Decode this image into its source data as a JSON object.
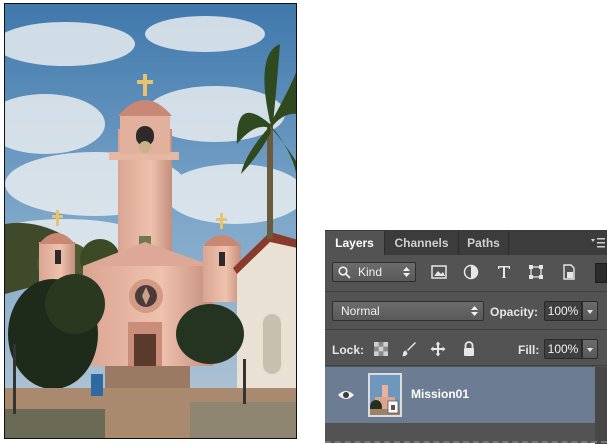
{
  "photo": {
    "subject": "Mission church with bell tower, palm tree and blue sky"
  },
  "layers_panel": {
    "tabs": [
      {
        "label": "Layers",
        "active": true
      },
      {
        "label": "Channels",
        "active": false
      },
      {
        "label": "Paths",
        "active": false
      }
    ],
    "filter": {
      "kind_label": "Kind",
      "icons": [
        "pixel-layer-filter-icon",
        "adjustment-layer-filter-icon",
        "type-layer-filter-icon",
        "shape-layer-filter-icon",
        "smart-object-filter-icon"
      ]
    },
    "blend_mode": "Normal",
    "opacity_label": "Opacity:",
    "opacity_value": "100%",
    "lock_label": "Lock:",
    "lock_icons": [
      "lock-transparent-pixels-icon",
      "lock-image-pixels-icon",
      "lock-position-icon",
      "lock-all-icon"
    ],
    "fill_label": "Fill:",
    "fill_value": "100%",
    "layers": [
      {
        "name": "Mission01",
        "visible": true,
        "selected": true
      }
    ]
  },
  "colors": {
    "panel_bg": "#535353",
    "tabbar_bg": "#3c3c3c",
    "selected_layer": "#6b7c93"
  }
}
